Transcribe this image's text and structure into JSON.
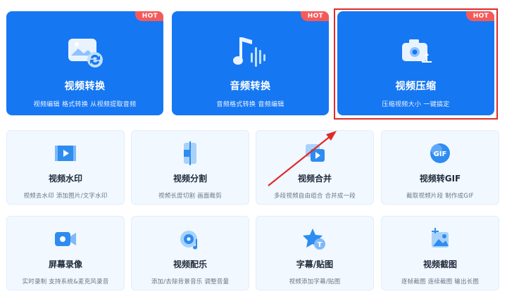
{
  "hot_badge": "HOT",
  "featured": [
    {
      "title": "视频转换",
      "subtitle": "视频编辑 格式转换 从视频提取音频",
      "icon": "video-convert-icon",
      "hot": true
    },
    {
      "title": "音频转换",
      "subtitle": "音频格式转换 音频编辑",
      "icon": "audio-convert-icon",
      "hot": true
    },
    {
      "title": "视频压缩",
      "subtitle": "压缩视频大小 一键搞定",
      "icon": "video-compress-icon",
      "hot": true
    }
  ],
  "tools": [
    {
      "title": "视频水印",
      "subtitle": "视频去水印 添加图片/文字水印",
      "icon": "video-watermark-icon"
    },
    {
      "title": "视频分割",
      "subtitle": "视频长度切割 画面裁剪",
      "icon": "video-split-icon"
    },
    {
      "title": "视频合并",
      "subtitle": "多段视频自由组合 合并成一段",
      "icon": "video-merge-icon"
    },
    {
      "title": "视频转GIF",
      "subtitle": "截取视频片段 制作成GIF",
      "icon": "gif-icon"
    },
    {
      "title": "屏幕录像",
      "subtitle": "实时录制 支持系统&麦克风录音",
      "icon": "screen-record-icon"
    },
    {
      "title": "视频配乐",
      "subtitle": "添加/去除背景音乐 调整音量",
      "icon": "music-disc-icon"
    },
    {
      "title": "字幕/贴图",
      "subtitle": "视频添加字幕/贴图",
      "icon": "subtitle-star-icon"
    },
    {
      "title": "视频截图",
      "subtitle": "逐帧截图 连续截图 输出长图",
      "icon": "screenshot-icon"
    }
  ],
  "icon_text": {
    "gif": "GIF",
    "subtitle": "T"
  },
  "colors": {
    "primary": "#1677f2",
    "hot": "#f55a5a",
    "highlight": "#e02a2a",
    "card_bg": "#f1f8ff"
  }
}
